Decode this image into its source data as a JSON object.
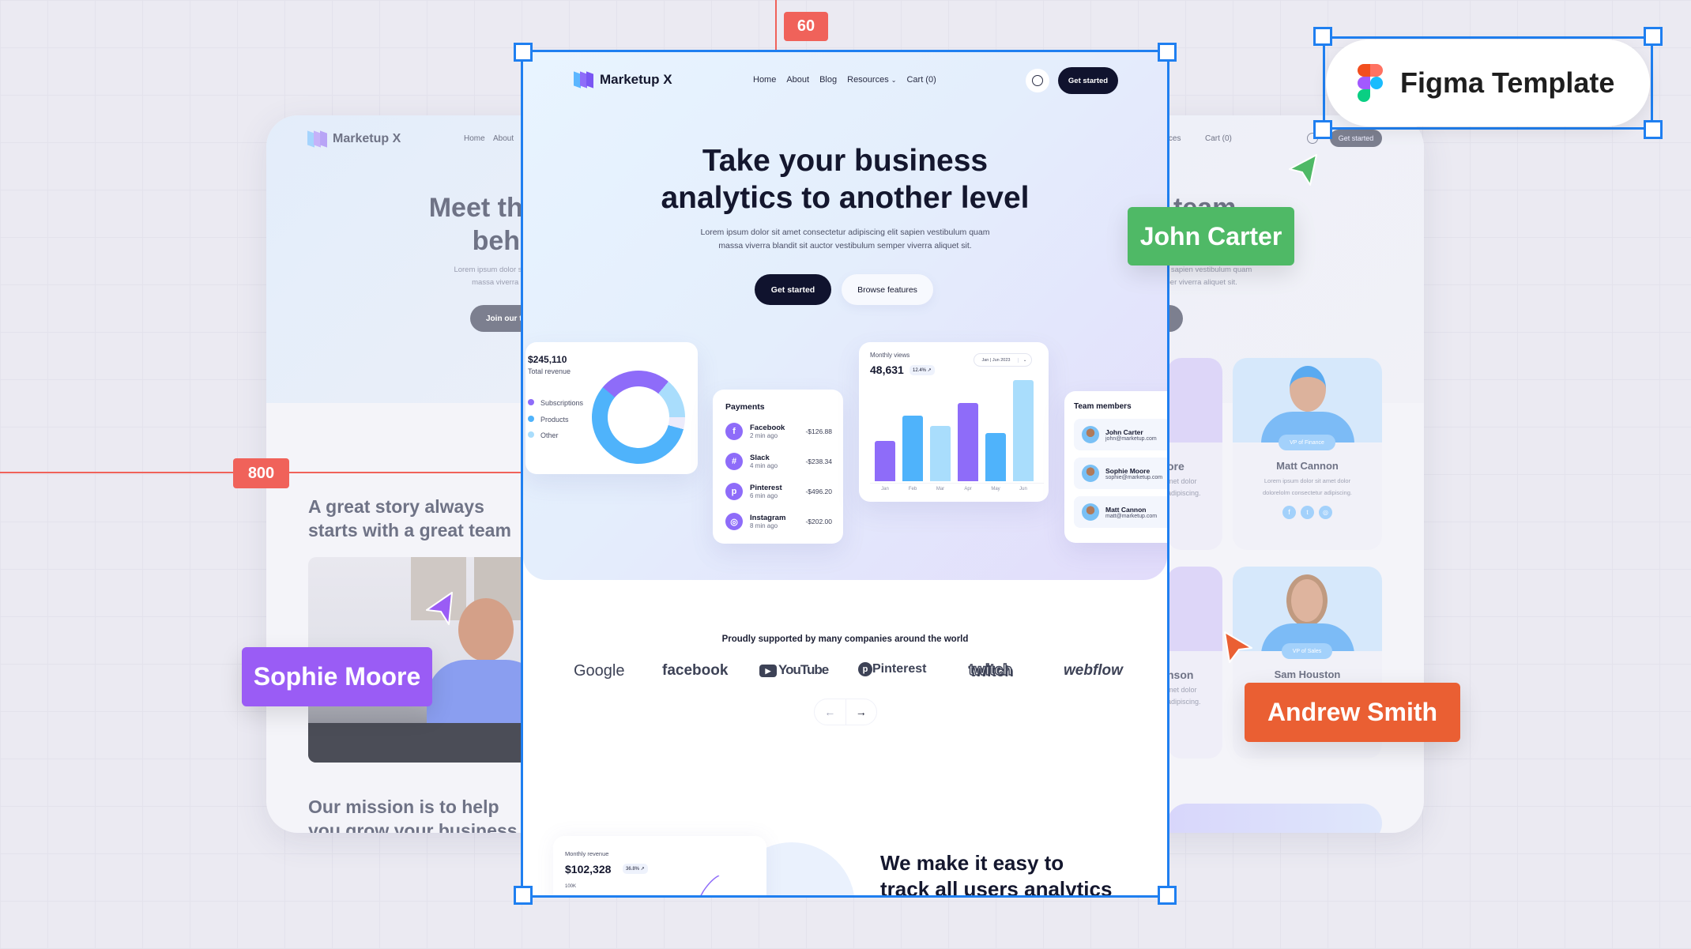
{
  "canvas": {
    "ruler_top": "60",
    "ruler_left": "800",
    "accent": "#1f7ff0",
    "ruler_color": "#f0625a"
  },
  "figma_badge": {
    "label": "Figma Template",
    "icon": "figma-logo-icon"
  },
  "cursors": [
    {
      "name": "John Carter",
      "color": "#4fb966"
    },
    {
      "name": "Sophie Moore",
      "color": "#9a5cf5"
    },
    {
      "name": "Andrew Smith",
      "color": "#ea5f33"
    }
  ],
  "back_page": {
    "brand": "Marketup X",
    "nav": [
      "Home",
      "About"
    ],
    "nav_right": [
      "urces",
      "Cart (0)"
    ],
    "get_started": "Get started",
    "title_left": [
      "Meet the a",
      "behind"
    ],
    "title_right": "team",
    "lorem_left": [
      "Lorem ipsum dolor sit amet conse",
      "massa viverra blandit sit auc"
    ],
    "lorem_right": [
      "cing elit sapien vestibulum quam",
      "m semper viverra aliquet sit."
    ],
    "join_button": "Join our tea",
    "story_title": [
      "A great story always",
      "starts with a great team"
    ],
    "mission_title": [
      "Our mission is to help",
      "you grow your business"
    ],
    "team": [
      {
        "name": "Matt Cannon",
        "role": "VP of Finance",
        "bio": [
          "Lorem ipsum dolor sit amet dolor",
          "dolorelolm consectetur adipiscing."
        ]
      },
      {
        "name": "Sam Houston",
        "role": "VP of Sales"
      }
    ],
    "partial_team": [
      {
        "name_fragment": "ore",
        "bio": [
          "met dolor",
          "adipiscing."
        ]
      },
      {
        "name_fragment": "nson",
        "bio": [
          "met dolor",
          "adipiscing."
        ]
      }
    ]
  },
  "page": {
    "brand": "Marketup X",
    "nav": {
      "home": "Home",
      "about": "About",
      "blog": "Blog",
      "resources": "Resources",
      "cart": "Cart (0)"
    },
    "get_started": "Get started",
    "hero": {
      "title": [
        "Take your business",
        "analytics to another level"
      ],
      "subtitle": [
        "Lorem ipsum dolor sit amet consectetur adipiscing elit sapien vestibulum quam",
        "massa viverra blandit sit auctor vestibulum semper viverra aliquet sit."
      ],
      "primary": "Get started",
      "secondary": "Browse features"
    },
    "revenue": {
      "amount": "$245,110",
      "label": "Total revenue",
      "legend": [
        {
          "label": "Subscriptions",
          "color": "#8e6cf9"
        },
        {
          "label": "Products",
          "color": "#4fb3fb"
        },
        {
          "label": "Other",
          "color": "#a9ddfc"
        }
      ]
    },
    "payments": {
      "title": "Payments",
      "items": [
        {
          "name": "Facebook",
          "time": "2 min ago",
          "amount": "-$126.88",
          "icon": "facebook-icon"
        },
        {
          "name": "Slack",
          "time": "4 min ago",
          "amount": "-$238.34",
          "icon": "slack-icon"
        },
        {
          "name": "Pinterest",
          "time": "6 min ago",
          "amount": "-$496.20",
          "icon": "pinterest-icon"
        },
        {
          "name": "Instagram",
          "time": "8 min ago",
          "amount": "-$202.00",
          "icon": "instagram-icon"
        }
      ]
    },
    "views": {
      "title": "Monthly views",
      "value": "48,631",
      "change": "12.4% ↗",
      "range": "Jan | Jun 2023",
      "bars": [
        {
          "month": "Jan",
          "level": 0.4,
          "color": "#8e6cf9"
        },
        {
          "month": "Feb",
          "level": 0.65,
          "color": "#4fb3fb"
        },
        {
          "month": "Mar",
          "level": 0.55,
          "color": "#a9ddfc"
        },
        {
          "month": "Apr",
          "level": 0.77,
          "color": "#8e6cf9"
        },
        {
          "month": "May",
          "level": 0.48,
          "color": "#4fb3fb"
        },
        {
          "month": "Jun",
          "level": 1.0,
          "color": "#a9ddfc"
        }
      ]
    },
    "team": {
      "title": "Team members",
      "members": [
        {
          "name": "John Carter",
          "email": "john@marketup.com"
        },
        {
          "name": "Sophie Moore",
          "email": "sophie@marketup.com"
        },
        {
          "name": "Matt Cannon",
          "email": "matt@marketup.com"
        }
      ]
    },
    "supported": "Proudly supported by many companies around the world",
    "logos": [
      "Google",
      "facebook",
      "YouTube",
      "Pinterest",
      "twitch",
      "webflow"
    ],
    "monthly_revenue": {
      "title": "Monthly revenue",
      "value": "$102,328",
      "change": "36.8% ↗",
      "axis": "100K"
    },
    "feature_title": [
      "We make it easy to",
      "track all users analytics"
    ]
  }
}
